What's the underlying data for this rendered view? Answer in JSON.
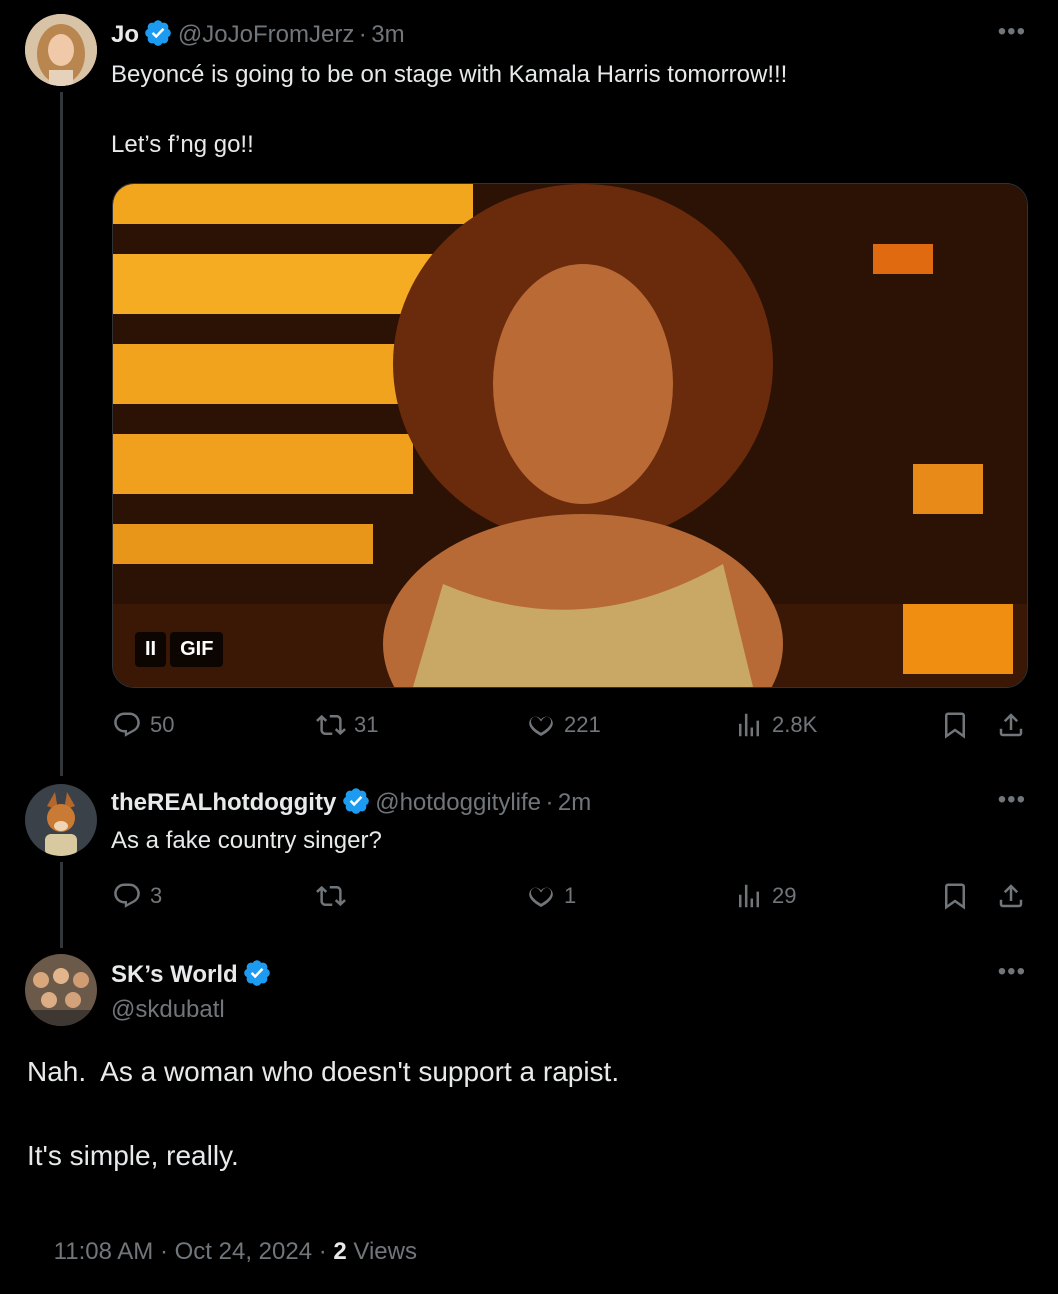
{
  "tweet1": {
    "name": "Jo",
    "handle": "@JoJoFromJerz",
    "time": "3m",
    "text1": "Beyoncé is going to be on stage with Kamala Harris tomorrow!!!",
    "text2": "Let’s f’ng go!!",
    "media_label": "GIF",
    "stats": {
      "replies": "50",
      "retweets": "31",
      "likes": "221",
      "views": "2.8K"
    }
  },
  "tweet2": {
    "name": "theREALhotdoggity",
    "handle": "@hotdoggitylife",
    "time": "2m",
    "text": "As a fake country singer?",
    "stats": {
      "replies": "3",
      "retweets": "",
      "likes": "1",
      "views": "29"
    }
  },
  "tweet3": {
    "name": "SK’s World",
    "handle": "@skdubatl",
    "text1": "Nah.  As a woman who doesn't support a rapist.",
    "text2": "It's simple, really.",
    "timestamp": "11:08 AM · Oct 24, 2024 · ",
    "views_count": "2",
    "views_label": " Views"
  },
  "icons": [
    "more-icon",
    "verified-icon",
    "reply-icon",
    "retweet-icon",
    "like-icon",
    "views-icon",
    "bookmark-icon",
    "share-icon",
    "pause-icon"
  ],
  "colors": {
    "background": "#000000",
    "text": "#e7e9ea",
    "muted": "#71767b",
    "verified": "#1d9bf0"
  }
}
